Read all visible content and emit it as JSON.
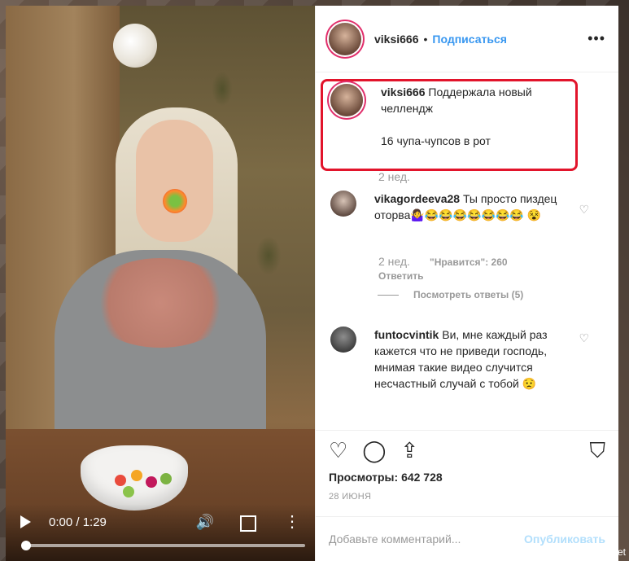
{
  "colors": {
    "follow": "#3897f0",
    "highlight": "#e2142b",
    "publish_disabled": "#b2dffc"
  },
  "video": {
    "current_time": "0:00",
    "duration": "1:29",
    "time_label": "0:00 / 1:29",
    "progress": 0.0
  },
  "header": {
    "username": "viksi666",
    "separator": "•",
    "follow_label": "Подписаться",
    "more_icon": "more-horizontal-icon"
  },
  "caption": {
    "username": "viksi666",
    "line1": "Поддержала новый челлендж",
    "line2": "16 чупа-чупсов в рот",
    "age": "2 нед."
  },
  "comments": [
    {
      "username": "vikagordeeva28",
      "text": "Ты просто пиздец оторва🤷‍♀️😂😂😂😂😂😂😂 😵",
      "age": "2 нед.",
      "likes_label": "\"Нравится\": 260",
      "reply_label": "Ответить",
      "view_replies": "Посмотреть ответы (5)"
    },
    {
      "username": "funtocvintik",
      "text": "Ви, мне каждый раз кажется что не приведи господь, мнимая такие видео случится несчастный случай с тобой 😟"
    }
  ],
  "actions": {
    "like_icon": "heart-icon",
    "comment_icon": "comment-icon",
    "share_icon": "share-icon",
    "save_icon": "bookmark-icon"
  },
  "stats": {
    "views_label": "Просмотры:",
    "views_value": "642 728",
    "date": "28 ИЮНЯ"
  },
  "add_comment": {
    "placeholder": "Добавьте комментарий...",
    "publish_label": "Опубликовать"
  },
  "watermark": "Fishki.net"
}
